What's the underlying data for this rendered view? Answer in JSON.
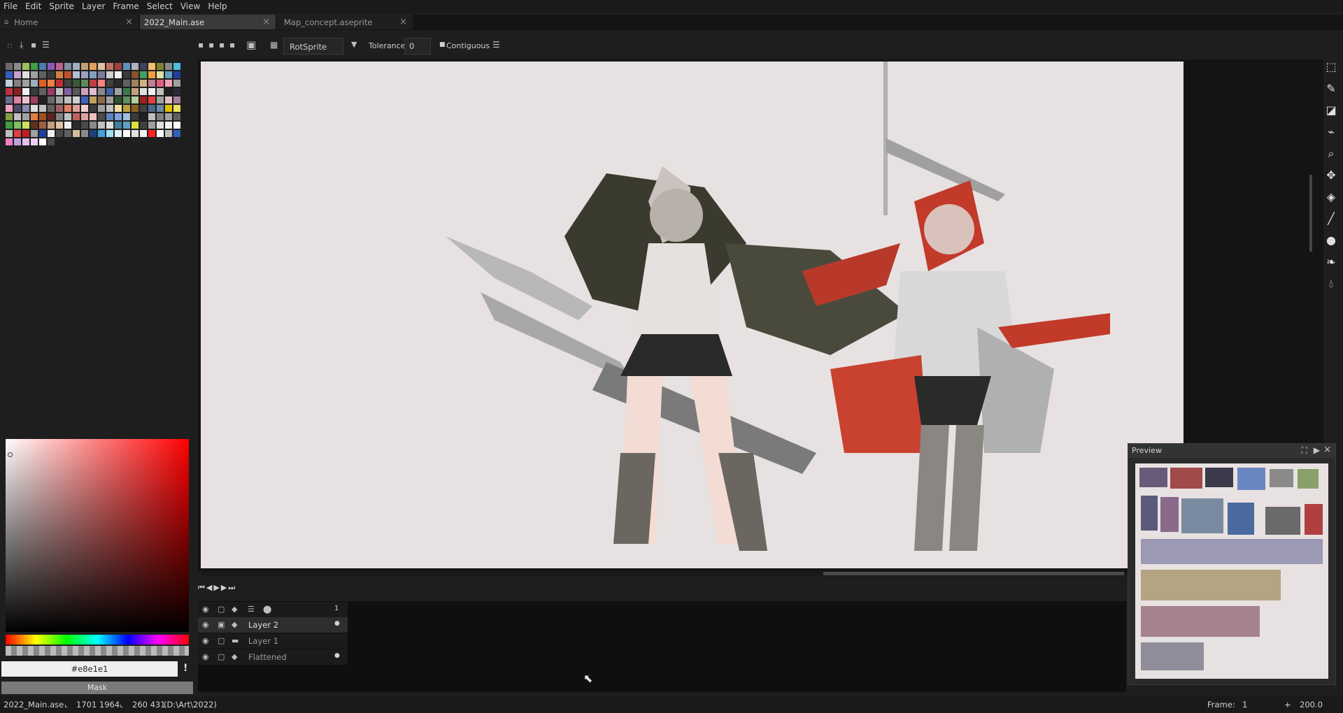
{
  "menu": [
    "File",
    "Edit",
    "Sprite",
    "Layer",
    "Frame",
    "Select",
    "View",
    "Help"
  ],
  "tabs": [
    {
      "label": "Home",
      "active": false
    },
    {
      "label": "2022_Main.ase",
      "active": true
    },
    {
      "label": "Map_concept.aseprite",
      "active": false
    }
  ],
  "tab_close_glyph": "×",
  "toolbar": {
    "rotation_algorithm": "RotSprite",
    "tolerance_label": "Tolerance:",
    "tolerance_value": "0",
    "contiguous_label": "Contiguous"
  },
  "palette": [
    "#6b6b6b",
    "#8a8a8a",
    "#a0c060",
    "#3fa048",
    "#4a7ab0",
    "#8a5ab0",
    "#c06090",
    "#8090a0",
    "#a0b0c0",
    "#c0a070",
    "#e0a060",
    "#e0c0a0",
    "#c07060",
    "#a04040",
    "#6090c0",
    "#b0b0c0",
    "#404060",
    "#f0c070",
    "#808030",
    "#8a8a8a",
    "#4ac0e0",
    "#3060c0",
    "#c8a0d0",
    "#e0e0e0",
    "#a0a0a0",
    "#606060",
    "#3a3a3a",
    "#d08040",
    "#c05030",
    "#b0c0d0",
    "#a0a0c0",
    "#80a0c0",
    "#7a7a9a",
    "#d0d0d0",
    "#f0f0f0",
    "#3a3a3a",
    "#8a5030",
    "#40a060",
    "#f0a040",
    "#e0e0a0",
    "#60a0c0",
    "#2040a0",
    "#c0d0e0",
    "#808080",
    "#a0a0a0",
    "#9ab0c0",
    "#e06020",
    "#f08040",
    "#c03030",
    "#404040",
    "#3a5a3a",
    "#5a8a5a",
    "#c04040",
    "#ff8080",
    "#404040",
    "#2a2a2a",
    "#606060",
    "#a08060",
    "#d0b080",
    "#c08090",
    "#e06080",
    "#f0a0b0",
    "#a0a0a0",
    "#c03040",
    "#8a2020",
    "#f0f0f0",
    "#3a3a3a",
    "#606060",
    "#9a3a6a",
    "#c0c0c0",
    "#8060a0",
    "#5a5a5a",
    "#d0a0c0",
    "#e0c0d0",
    "#8a8a8a",
    "#4060a0",
    "#a0a0a0",
    "#3a7a4a",
    "#c0a080",
    "#e0e0e0",
    "#f0f0f0",
    "#c0c0c0",
    "#202020",
    "#2a2a3a",
    "#6a6a8a",
    "#e080a0",
    "#f0c0d0",
    "#a04060",
    "#202020",
    "#6a6a6a",
    "#a0a0a0",
    "#c0c0c0",
    "#d0d0d0",
    "#4060c0",
    "#c0a060",
    "#8a6a4a",
    "#a0a0a0",
    "#305030",
    "#609060",
    "#b0d0a0",
    "#a02020",
    "#e04040",
    "#a0a0a0",
    "#e0c0c0",
    "#a080a0",
    "#f0a0c0",
    "#4a4a6a",
    "#8a8aaa",
    "#e0e0e0",
    "#c0c0c0",
    "#606060",
    "#a06060",
    "#e08060",
    "#e0a0a0",
    "#f0d0d0",
    "#3a3a3a",
    "#a0a0a0",
    "#c0c0c0",
    "#f0e0a0",
    "#c0a040",
    "#8a6020",
    "#404040",
    "#4a6a8a",
    "#6a8aaa",
    "#e0c000",
    "#f0e060",
    "#80a040",
    "#c0c0c0",
    "#a0a0a0",
    "#e08040",
    "#a05020",
    "#602020",
    "#808080",
    "#c0c0c0",
    "#c06060",
    "#e0a0a0",
    "#f0c0c0",
    "#4a4a4a",
    "#6080c0",
    "#80a0e0",
    "#a0c0e0",
    "#3a3a3a",
    "#202020",
    "#c0c0c0",
    "#808080",
    "#a0a0a0",
    "#606060",
    "#40a040",
    "#80c060",
    "#d0e060",
    "#603020",
    "#a06040",
    "#c0a080",
    "#e0c0a0",
    "#f0f0f0",
    "#2a2a2a",
    "#4a4a4a",
    "#8a8a8a",
    "#c0c0c0",
    "#e0e0e0",
    "#4080a0",
    "#60a0c0",
    "#e0e040",
    "#404040",
    "#a0a0a0",
    "#e0e0e0",
    "#f0f0f0",
    "#ffffff",
    "#c0c0c0",
    "#e04040",
    "#c02020",
    "#a0a0a0",
    "#2040a0",
    "#f0f0f0",
    "#4a4a4a",
    "#606060",
    "#d0c0a0",
    "#8a8a8a",
    "#204080",
    "#40a0e0",
    "#a0e0f0",
    "#e0f0f0",
    "#ffffff",
    "#e0e0e0",
    "#f0f0f0",
    "#ff2020",
    "#ffffff",
    "#c0c0c0",
    "#3060c0",
    "#f080c0",
    "#c0a0e0",
    "#e0c0f0",
    "#f0d0f0",
    "#ffffff",
    "#4a4a4a"
  ],
  "color_picker": {
    "hex_value": "#e8e1e1",
    "mask_label": "Mask"
  },
  "timeline": {
    "frame_header": "1",
    "layers": [
      {
        "name": "Layer 2",
        "selected": true,
        "has_cel": true
      },
      {
        "name": "Layer 1",
        "selected": false,
        "has_cel": false
      },
      {
        "name": "Flattened",
        "selected": false,
        "has_cel": true
      }
    ]
  },
  "preview": {
    "title": "Preview"
  },
  "status": {
    "file": "2022_Main.ase",
    "size": "1701 1964",
    "pos": "260 431",
    "path": "(D:\\Art\\2022)",
    "frame_label": "Frame:",
    "frame_value": "1",
    "zoom": "200.0"
  }
}
